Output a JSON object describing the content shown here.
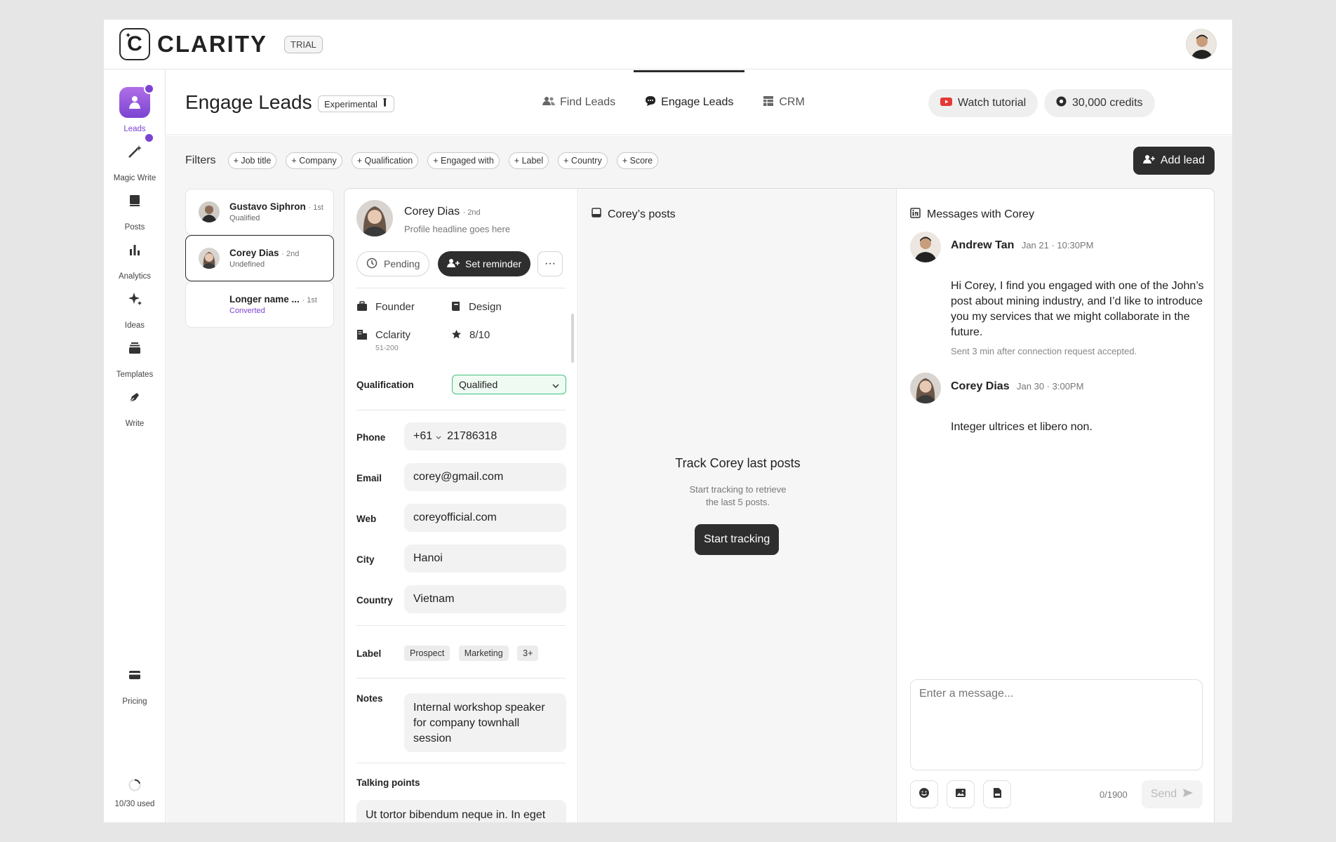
{
  "brand": {
    "name": "CLARITY",
    "badge": "TRIAL"
  },
  "rail": {
    "items": [
      {
        "label": "Leads",
        "icon": "leads-icon"
      },
      {
        "label": "Magic Write",
        "icon": "magic-wand-icon"
      },
      {
        "label": "Posts",
        "icon": "posts-icon"
      },
      {
        "label": "Analytics",
        "icon": "bar-chart-icon"
      },
      {
        "label": "Ideas",
        "icon": "sparkle-icon"
      },
      {
        "label": "Templates",
        "icon": "templates-icon"
      },
      {
        "label": "Write",
        "icon": "pen-icon"
      }
    ],
    "pricing": "Pricing",
    "usage": "10/30 used"
  },
  "page": {
    "title": "Engage Leads",
    "badge": "Experimental",
    "tabs": [
      {
        "label": "Find Leads"
      },
      {
        "label": "Engage Leads"
      },
      {
        "label": "CRM"
      }
    ],
    "watch_tutorial": "Watch tutorial",
    "credits": "30,000 credits"
  },
  "filters": {
    "label": "Filters",
    "chips": [
      "+ Job title",
      "+ Company",
      "+ Qualification",
      "+ Engaged with",
      "+ Label",
      "+ Country",
      "+ Score"
    ],
    "add_lead": "Add lead"
  },
  "leads": [
    {
      "name": "Gustavo Siphron",
      "degree": "· 1st",
      "status": "Qualified"
    },
    {
      "name": "Corey Dias",
      "degree": "· 2nd",
      "status": "Undefined"
    },
    {
      "name": "Longer name ...",
      "degree": "· 1st",
      "status": "Converted"
    }
  ],
  "profile": {
    "name": "Corey Dias",
    "degree": "· 2nd",
    "headline": "Profile headline goes here",
    "pending": "Pending",
    "set_reminder": "Set reminder",
    "more": "···",
    "role": "Founder",
    "department": "Design",
    "company": "Cclarity",
    "company_size": "51-200",
    "score": "8/10",
    "qualification_label": "Qualification",
    "qualification_value": "Qualified",
    "phone_label": "Phone",
    "phone_code": "+61",
    "phone_number": "21786318",
    "email_label": "Email",
    "email": "corey@gmail.com",
    "web_label": "Web",
    "web": "coreyofficial.com",
    "city_label": "City",
    "city": "Hanoi",
    "country_label": "Country",
    "country": "Vietnam",
    "label_label": "Label",
    "labels": [
      "Prospect",
      "Marketing",
      "3+"
    ],
    "notes_label": "Notes",
    "notes": "Internal workshop speaker for company townhall session",
    "talking_label": "Talking points",
    "talking": "Ut tortor bibendum neque in. In eget"
  },
  "posts": {
    "title": "Corey’s posts",
    "empty_title": "Track Corey last posts",
    "empty_sub_1": "Start tracking to retrieve",
    "empty_sub_2": "the last 5 posts.",
    "button": "Start tracking"
  },
  "messages": {
    "title": "Messages with Corey",
    "items": [
      {
        "name": "Andrew Tan",
        "time": "Jan 21 · 10:30PM",
        "text": "Hi Corey, I find you engaged with one of the John’s post about mining industry, and I’d like to introduce you my services that we might collaborate in the future.",
        "meta": "Sent 3 min after connection request accepted."
      },
      {
        "name": "Corey Dias",
        "time": "Jan 30 · 3:00PM",
        "text": "Integer ultrices et libero non."
      }
    ],
    "placeholder": "Enter a message...",
    "counter": "0/1900",
    "send": "Send"
  },
  "colors": {
    "accent": "#7a43d2",
    "dark": "#2e2e2e",
    "qualified_border": "#3fc37f",
    "youtube": "#e53935"
  }
}
